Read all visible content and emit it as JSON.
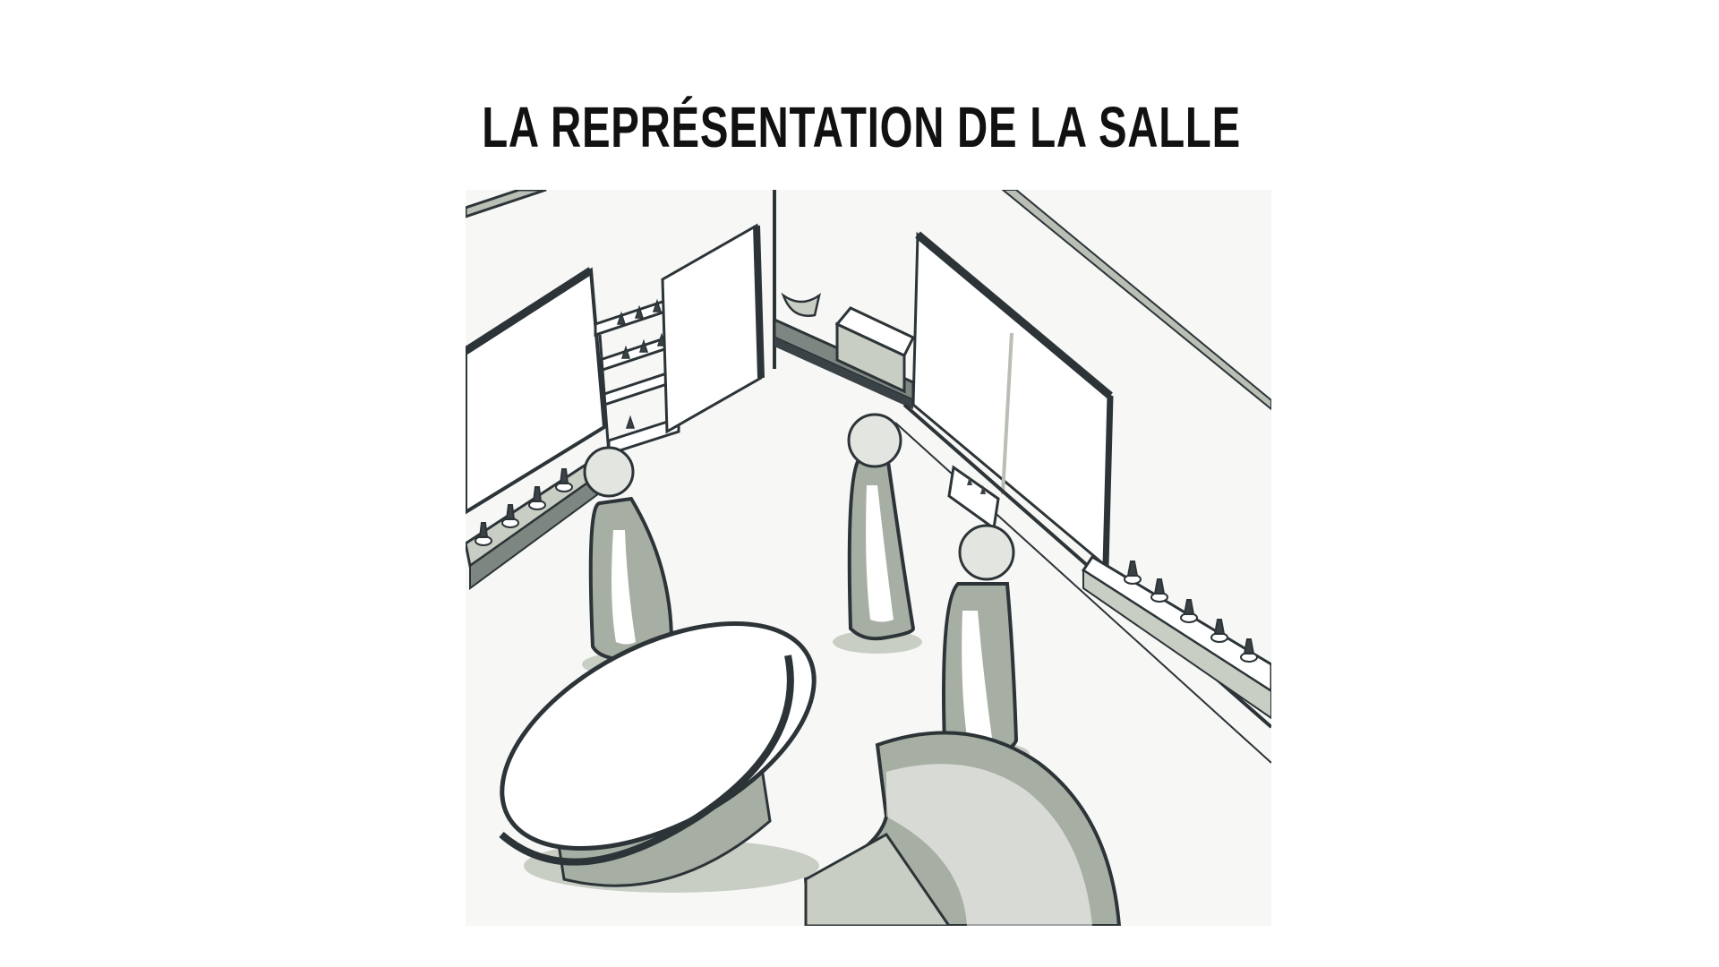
{
  "slide": {
    "title": "LA REPRÉSENTATION DE LA SALLE"
  },
  "illustration": {
    "subject": "sketch-of-shop-room",
    "palette": {
      "background": "#ffffff",
      "paper": "#f7f7f6",
      "ink": "#2c3438",
      "shade": "#a7aea3",
      "light_shade": "#c9cec4"
    }
  }
}
